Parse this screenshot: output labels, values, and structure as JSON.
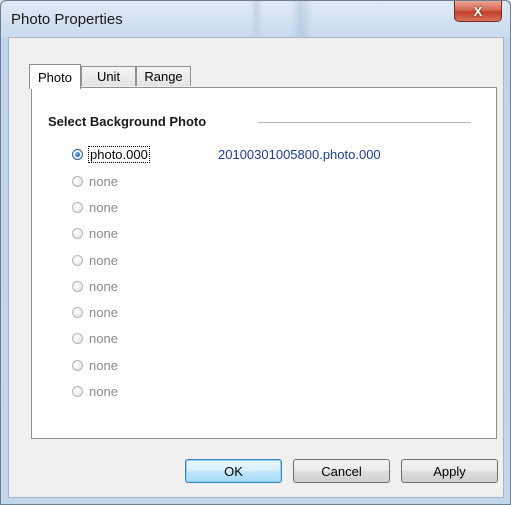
{
  "window": {
    "title": "Photo Properties",
    "close_label": "X"
  },
  "tabs": [
    {
      "label": "Photo",
      "active": true
    },
    {
      "label": "Unit",
      "active": false
    },
    {
      "label": "Range",
      "active": false
    }
  ],
  "photo_tab": {
    "section_title": "Select Background Photo",
    "selected_filename": "20100301005800.photo.000",
    "options": [
      {
        "label": "photo.000",
        "checked": true,
        "enabled": true
      },
      {
        "label": "none",
        "checked": false,
        "enabled": false
      },
      {
        "label": "none",
        "checked": false,
        "enabled": false
      },
      {
        "label": "none",
        "checked": false,
        "enabled": false
      },
      {
        "label": "none",
        "checked": false,
        "enabled": false
      },
      {
        "label": "none",
        "checked": false,
        "enabled": false
      },
      {
        "label": "none",
        "checked": false,
        "enabled": false
      },
      {
        "label": "none",
        "checked": false,
        "enabled": false
      },
      {
        "label": "none",
        "checked": false,
        "enabled": false
      },
      {
        "label": "none",
        "checked": false,
        "enabled": false
      }
    ]
  },
  "buttons": {
    "ok": "OK",
    "cancel": "Cancel",
    "apply": "Apply"
  }
}
